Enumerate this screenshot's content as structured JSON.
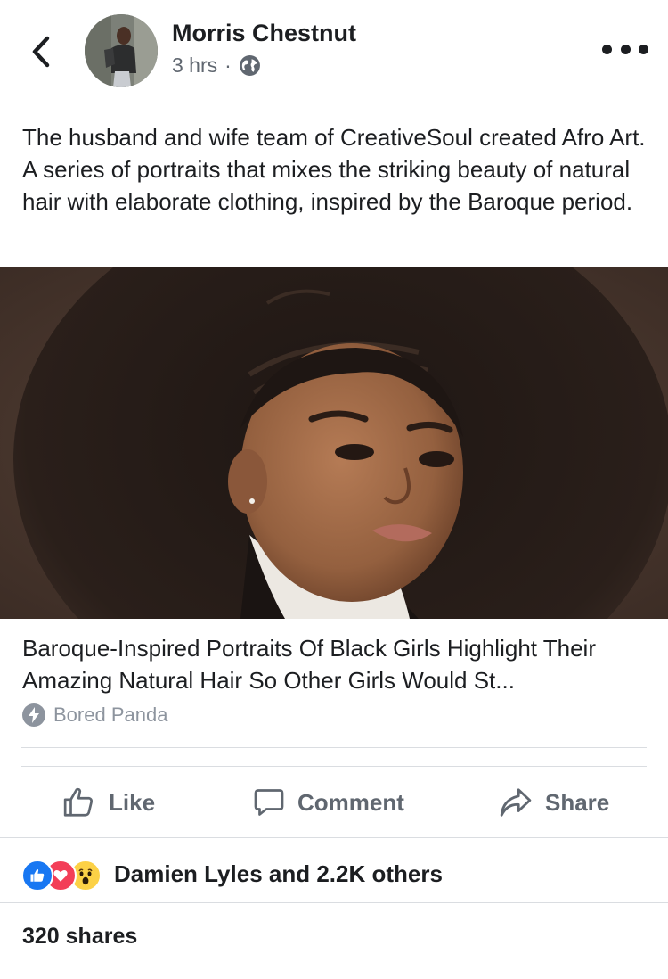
{
  "post": {
    "author": "Morris Chestnut",
    "time": "3 hrs",
    "separator": "·",
    "privacy_icon": "globe-icon",
    "text": "The husband and wife team of CreativeSoul created Afro Art. A series of portraits that mixes the striking beauty of natural hair with elaborate clothing, inspired by the Baroque period."
  },
  "link": {
    "title": "Baroque-Inspired Portraits Of Black Girls Highlight Their Amazing Natural Hair So Other Girls Would St...",
    "source": "Bored Panda",
    "source_icon": "lightning-bolt-icon"
  },
  "actions": {
    "like": "Like",
    "comment": "Comment",
    "share": "Share"
  },
  "reactions": {
    "icons": [
      "like-reaction-icon",
      "love-reaction-icon",
      "wow-reaction-icon"
    ],
    "summary": "Damien Lyles and 2.2K others"
  },
  "shares": "320 shares",
  "colors": {
    "like_blue": "#1877f2",
    "love_red": "#f33e58",
    "wow_yellow": "#fcd146",
    "secondary_text": "#606770",
    "divider": "#dadde1"
  }
}
